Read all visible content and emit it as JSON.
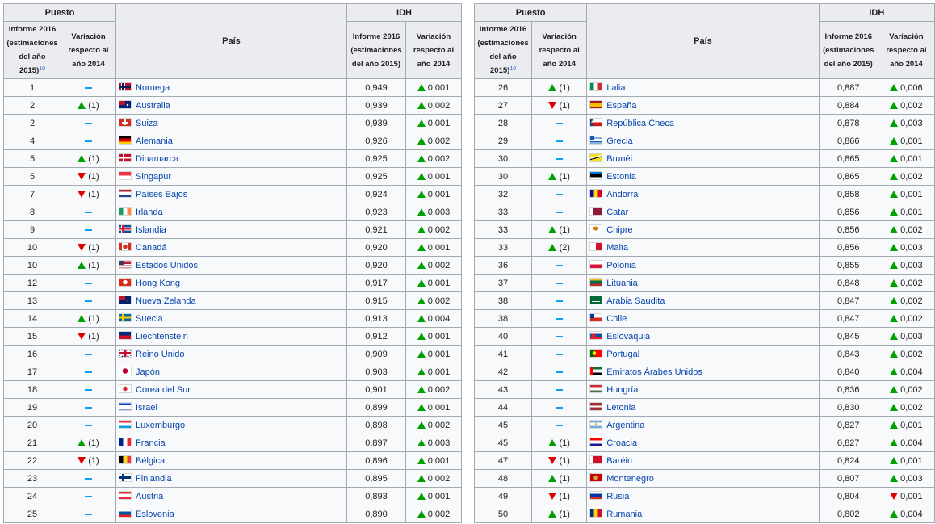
{
  "headers": {
    "puesto": "Puesto",
    "pais": "País",
    "idh": "IDH",
    "informe_puesto": "Informe 2016 (estimaciones del año 2015)",
    "note": "10",
    "variacion": "Variación respecto al año 2014",
    "informe_idh": "Informe 2016 (estimaciones del año 2015)",
    "variacion_idh": "Variación respecto al año 2014"
  },
  "tables": [
    {
      "rows": [
        {
          "rank": "1",
          "var": "same",
          "varText": "",
          "country": "Noruega",
          "flag": "no",
          "idh": "0,949",
          "chg": "up",
          "chgText": "0,001"
        },
        {
          "rank": "2",
          "var": "up",
          "varText": "(1)",
          "country": "Australia",
          "flag": "au",
          "idh": "0,939",
          "chg": "up",
          "chgText": "0,002"
        },
        {
          "rank": "2",
          "var": "same",
          "varText": "",
          "country": "Suiza",
          "flag": "ch",
          "idh": "0,939",
          "chg": "up",
          "chgText": "0,001"
        },
        {
          "rank": "4",
          "var": "same",
          "varText": "",
          "country": "Alemania",
          "flag": "de",
          "idh": "0,926",
          "chg": "up",
          "chgText": "0,002"
        },
        {
          "rank": "5",
          "var": "up",
          "varText": "(1)",
          "country": "Dinamarca",
          "flag": "dk",
          "idh": "0,925",
          "chg": "up",
          "chgText": "0,002"
        },
        {
          "rank": "5",
          "var": "down",
          "varText": "(1)",
          "country": "Singapur",
          "flag": "sg",
          "idh": "0,925",
          "chg": "up",
          "chgText": "0,001"
        },
        {
          "rank": "7",
          "var": "down",
          "varText": "(1)",
          "country": "Países Bajos",
          "flag": "nl",
          "idh": "0,924",
          "chg": "up",
          "chgText": "0,001"
        },
        {
          "rank": "8",
          "var": "same",
          "varText": "",
          "country": "Irlanda",
          "flag": "ie",
          "idh": "0,923",
          "chg": "up",
          "chgText": "0,003"
        },
        {
          "rank": "9",
          "var": "same",
          "varText": "",
          "country": "Islandia",
          "flag": "is",
          "idh": "0,921",
          "chg": "up",
          "chgText": "0,002"
        },
        {
          "rank": "10",
          "var": "down",
          "varText": "(1)",
          "country": "Canadá",
          "flag": "ca",
          "idh": "0,920",
          "chg": "up",
          "chgText": "0,001"
        },
        {
          "rank": "10",
          "var": "up",
          "varText": "(1)",
          "country": "Estados Unidos",
          "flag": "us",
          "idh": "0,920",
          "chg": "up",
          "chgText": "0,002"
        },
        {
          "rank": "12",
          "var": "same",
          "varText": "",
          "country": "Hong Kong",
          "flag": "hk",
          "idh": "0,917",
          "chg": "up",
          "chgText": "0,001"
        },
        {
          "rank": "13",
          "var": "same",
          "varText": "",
          "country": "Nueva Zelanda",
          "flag": "nz",
          "idh": "0,915",
          "chg": "up",
          "chgText": "0,002"
        },
        {
          "rank": "14",
          "var": "up",
          "varText": "(1)",
          "country": "Suecia",
          "flag": "se",
          "idh": "0,913",
          "chg": "up",
          "chgText": "0,004"
        },
        {
          "rank": "15",
          "var": "down",
          "varText": "(1)",
          "country": "Liechtenstein",
          "flag": "li",
          "idh": "0,912",
          "chg": "up",
          "chgText": "0,001"
        },
        {
          "rank": "16",
          "var": "same",
          "varText": "",
          "country": "Reino Unido",
          "flag": "gb",
          "idh": "0,909",
          "chg": "up",
          "chgText": "0,001"
        },
        {
          "rank": "17",
          "var": "same",
          "varText": "",
          "country": "Japón",
          "flag": "jp",
          "idh": "0,903",
          "chg": "up",
          "chgText": "0,001"
        },
        {
          "rank": "18",
          "var": "same",
          "varText": "",
          "country": "Corea del Sur",
          "flag": "kr",
          "idh": "0,901",
          "chg": "up",
          "chgText": "0,002"
        },
        {
          "rank": "19",
          "var": "same",
          "varText": "",
          "country": "Israel",
          "flag": "il",
          "idh": "0,899",
          "chg": "up",
          "chgText": "0,001"
        },
        {
          "rank": "20",
          "var": "same",
          "varText": "",
          "country": "Luxemburgo",
          "flag": "lu",
          "idh": "0,898",
          "chg": "up",
          "chgText": "0,002"
        },
        {
          "rank": "21",
          "var": "up",
          "varText": "(1)",
          "country": "Francia",
          "flag": "fr",
          "idh": "0,897",
          "chg": "up",
          "chgText": "0,003"
        },
        {
          "rank": "22",
          "var": "down",
          "varText": "(1)",
          "country": "Bélgica",
          "flag": "be",
          "idh": "0,896",
          "chg": "up",
          "chgText": "0,001"
        },
        {
          "rank": "23",
          "var": "same",
          "varText": "",
          "country": "Finlandia",
          "flag": "fi",
          "idh": "0,895",
          "chg": "up",
          "chgText": "0,002"
        },
        {
          "rank": "24",
          "var": "same",
          "varText": "",
          "country": "Austria",
          "flag": "at",
          "idh": "0,893",
          "chg": "up",
          "chgText": "0,001"
        },
        {
          "rank": "25",
          "var": "same",
          "varText": "",
          "country": "Eslovenia",
          "flag": "si",
          "idh": "0,890",
          "chg": "up",
          "chgText": "0,002"
        }
      ]
    },
    {
      "rows": [
        {
          "rank": "26",
          "var": "up",
          "varText": "(1)",
          "country": "Italia",
          "flag": "it",
          "idh": "0,887",
          "chg": "up",
          "chgText": "0,006"
        },
        {
          "rank": "27",
          "var": "down",
          "varText": "(1)",
          "country": "España",
          "flag": "es",
          "idh": "0,884",
          "chg": "up",
          "chgText": "0,002"
        },
        {
          "rank": "28",
          "var": "same",
          "varText": "",
          "country": "República Checa",
          "flag": "cz",
          "idh": "0,878",
          "chg": "up",
          "chgText": "0,003"
        },
        {
          "rank": "29",
          "var": "same",
          "varText": "",
          "country": "Grecia",
          "flag": "gr",
          "idh": "0,866",
          "chg": "up",
          "chgText": "0,001"
        },
        {
          "rank": "30",
          "var": "same",
          "varText": "",
          "country": "Brunéi",
          "flag": "bn",
          "idh": "0,865",
          "chg": "up",
          "chgText": "0,001"
        },
        {
          "rank": "30",
          "var": "up",
          "varText": "(1)",
          "country": "Estonia",
          "flag": "ee",
          "idh": "0,865",
          "chg": "up",
          "chgText": "0,002"
        },
        {
          "rank": "32",
          "var": "same",
          "varText": "",
          "country": "Andorra",
          "flag": "ad",
          "idh": "0,858",
          "chg": "up",
          "chgText": "0,001"
        },
        {
          "rank": "33",
          "var": "same",
          "varText": "",
          "country": "Catar",
          "flag": "qa",
          "idh": "0,856",
          "chg": "up",
          "chgText": "0,001"
        },
        {
          "rank": "33",
          "var": "up",
          "varText": "(1)",
          "country": "Chipre",
          "flag": "cy",
          "idh": "0,856",
          "chg": "up",
          "chgText": "0,002"
        },
        {
          "rank": "33",
          "var": "up",
          "varText": "(2)",
          "country": "Malta",
          "flag": "mt",
          "idh": "0,856",
          "chg": "up",
          "chgText": "0,003"
        },
        {
          "rank": "36",
          "var": "same",
          "varText": "",
          "country": "Polonia",
          "flag": "pl",
          "idh": "0,855",
          "chg": "up",
          "chgText": "0,003"
        },
        {
          "rank": "37",
          "var": "same",
          "varText": "",
          "country": "Lituania",
          "flag": "lt",
          "idh": "0,848",
          "chg": "up",
          "chgText": "0,002"
        },
        {
          "rank": "38",
          "var": "same",
          "varText": "",
          "country": "Arabia Saudita",
          "flag": "sa",
          "idh": "0,847",
          "chg": "up",
          "chgText": "0,002"
        },
        {
          "rank": "38",
          "var": "same",
          "varText": "",
          "country": "Chile",
          "flag": "cl",
          "idh": "0,847",
          "chg": "up",
          "chgText": "0,002"
        },
        {
          "rank": "40",
          "var": "same",
          "varText": "",
          "country": "Eslovaquia",
          "flag": "sk",
          "idh": "0,845",
          "chg": "up",
          "chgText": "0,003"
        },
        {
          "rank": "41",
          "var": "same",
          "varText": "",
          "country": "Portugal",
          "flag": "pt",
          "idh": "0,843",
          "chg": "up",
          "chgText": "0,002"
        },
        {
          "rank": "42",
          "var": "same",
          "varText": "",
          "country": "Emiratos Árabes Unidos",
          "flag": "ae",
          "idh": "0,840",
          "chg": "up",
          "chgText": "0,004"
        },
        {
          "rank": "43",
          "var": "same",
          "varText": "",
          "country": "Hungría",
          "flag": "hu",
          "idh": "0,836",
          "chg": "up",
          "chgText": "0,002"
        },
        {
          "rank": "44",
          "var": "same",
          "varText": "",
          "country": "Letonia",
          "flag": "lv",
          "idh": "0,830",
          "chg": "up",
          "chgText": "0,002"
        },
        {
          "rank": "45",
          "var": "same",
          "varText": "",
          "country": "Argentina",
          "flag": "ar",
          "idh": "0,827",
          "chg": "up",
          "chgText": "0,001"
        },
        {
          "rank": "45",
          "var": "up",
          "varText": "(1)",
          "country": "Croacia",
          "flag": "hr",
          "idh": "0,827",
          "chg": "up",
          "chgText": "0,004"
        },
        {
          "rank": "47",
          "var": "down",
          "varText": "(1)",
          "country": "Baréin",
          "flag": "bh",
          "idh": "0,824",
          "chg": "up",
          "chgText": "0,001"
        },
        {
          "rank": "48",
          "var": "up",
          "varText": "(1)",
          "country": "Montenegro",
          "flag": "me",
          "idh": "0,807",
          "chg": "up",
          "chgText": "0,003"
        },
        {
          "rank": "49",
          "var": "down",
          "varText": "(1)",
          "country": "Rusia",
          "flag": "ru",
          "idh": "0,804",
          "chg": "down",
          "chgText": "0,001"
        },
        {
          "rank": "50",
          "var": "up",
          "varText": "(1)",
          "country": "Rumania",
          "flag": "ro",
          "idh": "0,802",
          "chg": "up",
          "chgText": "0,004"
        }
      ]
    }
  ],
  "colors": {
    "link": "#0645ad",
    "header_bg": "#eaecf0",
    "cell_bg": "#f8f9fa",
    "border": "#a2a9b1",
    "up": "#00a000",
    "down": "#dd0000",
    "same": "#0a9ff0"
  }
}
